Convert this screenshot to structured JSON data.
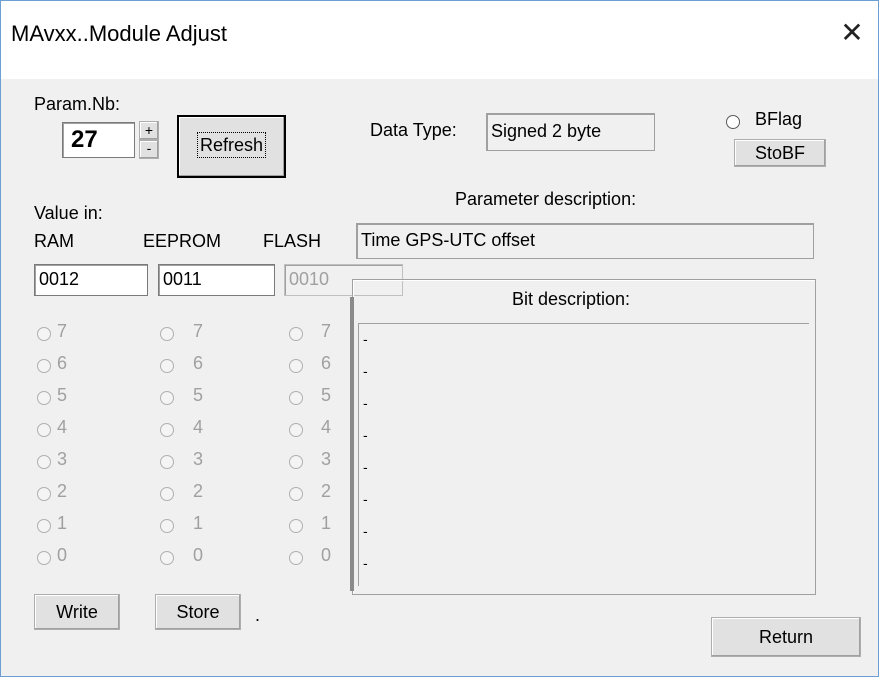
{
  "window": {
    "title": "MAvxx..Module Adjust",
    "close_glyph": "✕"
  },
  "param": {
    "label": "Param.Nb:",
    "value": "27",
    "plus": "+",
    "minus": "-",
    "refresh_label": "Refresh"
  },
  "data_type": {
    "label": "Data Type:",
    "value": "Signed 2 byte"
  },
  "bflag": {
    "label": "BFlag",
    "stobf_label": "StoBF"
  },
  "value_in": {
    "label": "Value in:",
    "col_ram": "RAM",
    "col_eeprom": "EEPROM",
    "col_flash": "FLASH"
  },
  "values": {
    "ram": "0012",
    "eeprom": "0011",
    "flash": "0010"
  },
  "param_desc": {
    "label": "Parameter description:",
    "value": "Time GPS-UTC offset"
  },
  "bit_desc": {
    "label": "Bit description:",
    "bits": [
      "-",
      "-",
      "-",
      "-",
      "-",
      "-",
      "-",
      "-"
    ]
  },
  "bit_numbers": [
    "7",
    "6",
    "5",
    "4",
    "3",
    "2",
    "1",
    "0"
  ],
  "buttons": {
    "write": "Write",
    "store": "Store",
    "status": ".",
    "return": "Return"
  }
}
